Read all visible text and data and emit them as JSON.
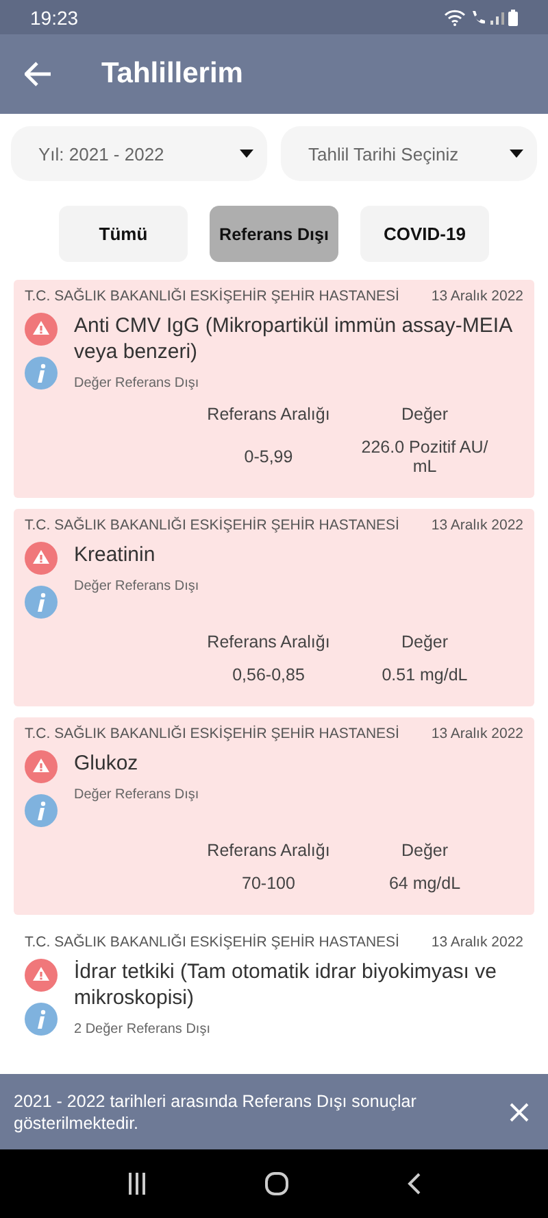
{
  "status_bar": {
    "time": "19:23"
  },
  "header": {
    "title": "Tahlillerim"
  },
  "filters": [
    {
      "label": "Yıl: 2021 - 2022"
    },
    {
      "label": "Tahlil Tarihi Seçiniz"
    }
  ],
  "tabs": [
    {
      "label": "Tümü",
      "selected": false
    },
    {
      "label": "Referans Dışı",
      "selected": true
    },
    {
      "label": "COVID-19",
      "selected": false
    }
  ],
  "results": [
    {
      "hospital": "T.C. SAĞLIK BAKANLIĞI ESKİŞEHİR ŞEHİR HASTANESİ",
      "date": "13 Aralık 2022",
      "name": "Anti CMV IgG (Mikropartikül immün assay-MEIA veya benzeri)",
      "note": "Değer Referans Dışı",
      "out_of_range": true,
      "range_label": "Referans Aralığı",
      "value_label": "Değer",
      "range": "0-5,99",
      "value": "226.0 Pozitif AU/ mL"
    },
    {
      "hospital": "T.C. SAĞLIK BAKANLIĞI ESKİŞEHİR ŞEHİR HASTANESİ",
      "date": "13 Aralık 2022",
      "name": "Kreatinin",
      "note": "Değer Referans Dışı",
      "out_of_range": true,
      "range_label": "Referans Aralığı",
      "value_label": "Değer",
      "range": "0,56-0,85",
      "value": "0.51 mg/dL"
    },
    {
      "hospital": "T.C. SAĞLIK BAKANLIĞI ESKİŞEHİR ŞEHİR HASTANESİ",
      "date": "13 Aralık 2022",
      "name": "Glukoz",
      "note": "Değer Referans Dışı",
      "out_of_range": true,
      "range_label": "Referans Aralığı",
      "value_label": "Değer",
      "range": "70-100",
      "value": "64 mg/dL"
    },
    {
      "hospital": "T.C. SAĞLIK BAKANLIĞI ESKİŞEHİR ŞEHİR HASTANESİ",
      "date": "13 Aralık 2022",
      "name": "İdrar tetkiki (Tam otomatik idrar biyokimyası ve mikroskopisi)",
      "note": "2 Değer Referans Dışı",
      "out_of_range": false
    }
  ],
  "snackbar": {
    "message": "2021 - 2022 tarihleri arasında Referans Dışı sonuçlar gösterilmektedir."
  }
}
